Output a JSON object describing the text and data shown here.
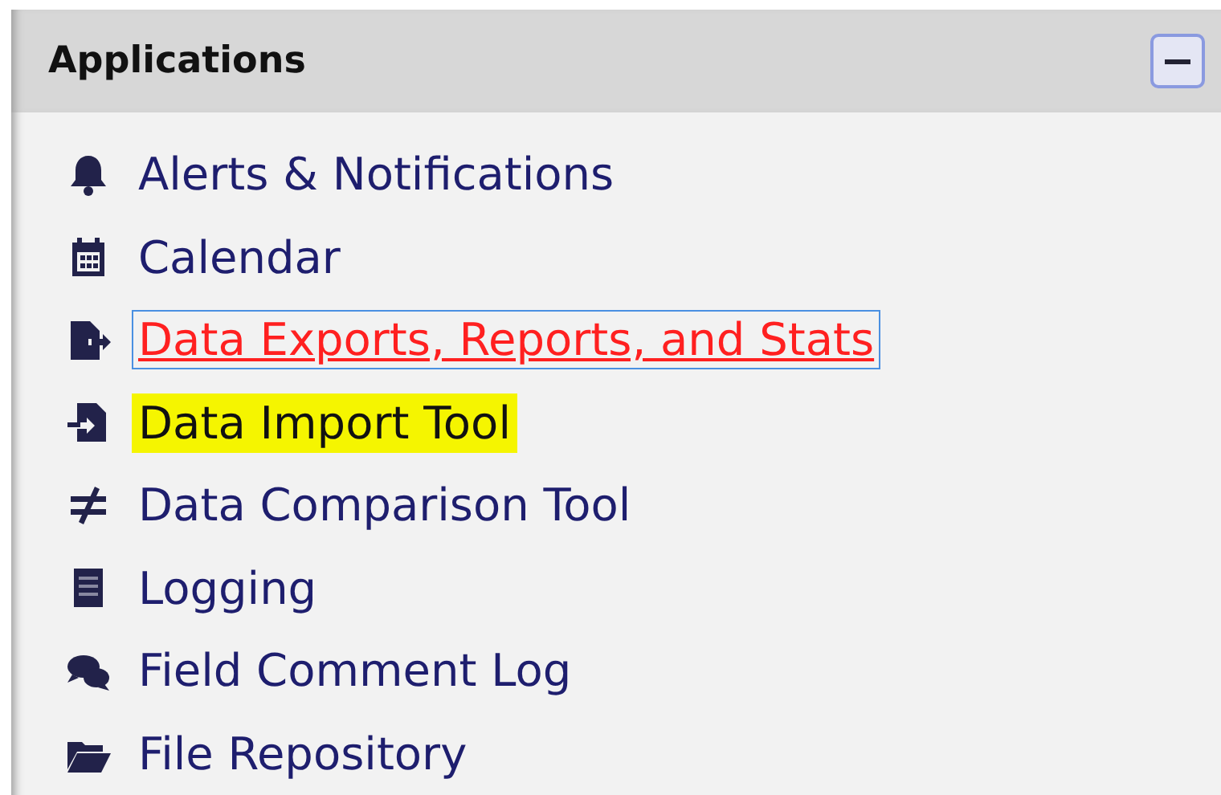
{
  "panel": {
    "title": "Applications",
    "collapse_button": {
      "expanded": true
    }
  },
  "items": [
    {
      "label": "Alerts & Notifications",
      "focused": false,
      "highlighted": false
    },
    {
      "label": "Calendar",
      "focused": false,
      "highlighted": false
    },
    {
      "label": "Data Exports, Reports, and Stats",
      "focused": true,
      "highlighted": false
    },
    {
      "label": "Data Import Tool",
      "focused": false,
      "highlighted": true
    },
    {
      "label": "Data Comparison Tool",
      "focused": false,
      "highlighted": false
    },
    {
      "label": "Logging",
      "focused": false,
      "highlighted": false
    },
    {
      "label": "Field Comment Log",
      "focused": false,
      "highlighted": false
    },
    {
      "label": "File Repository",
      "focused": false,
      "highlighted": false
    }
  ]
}
